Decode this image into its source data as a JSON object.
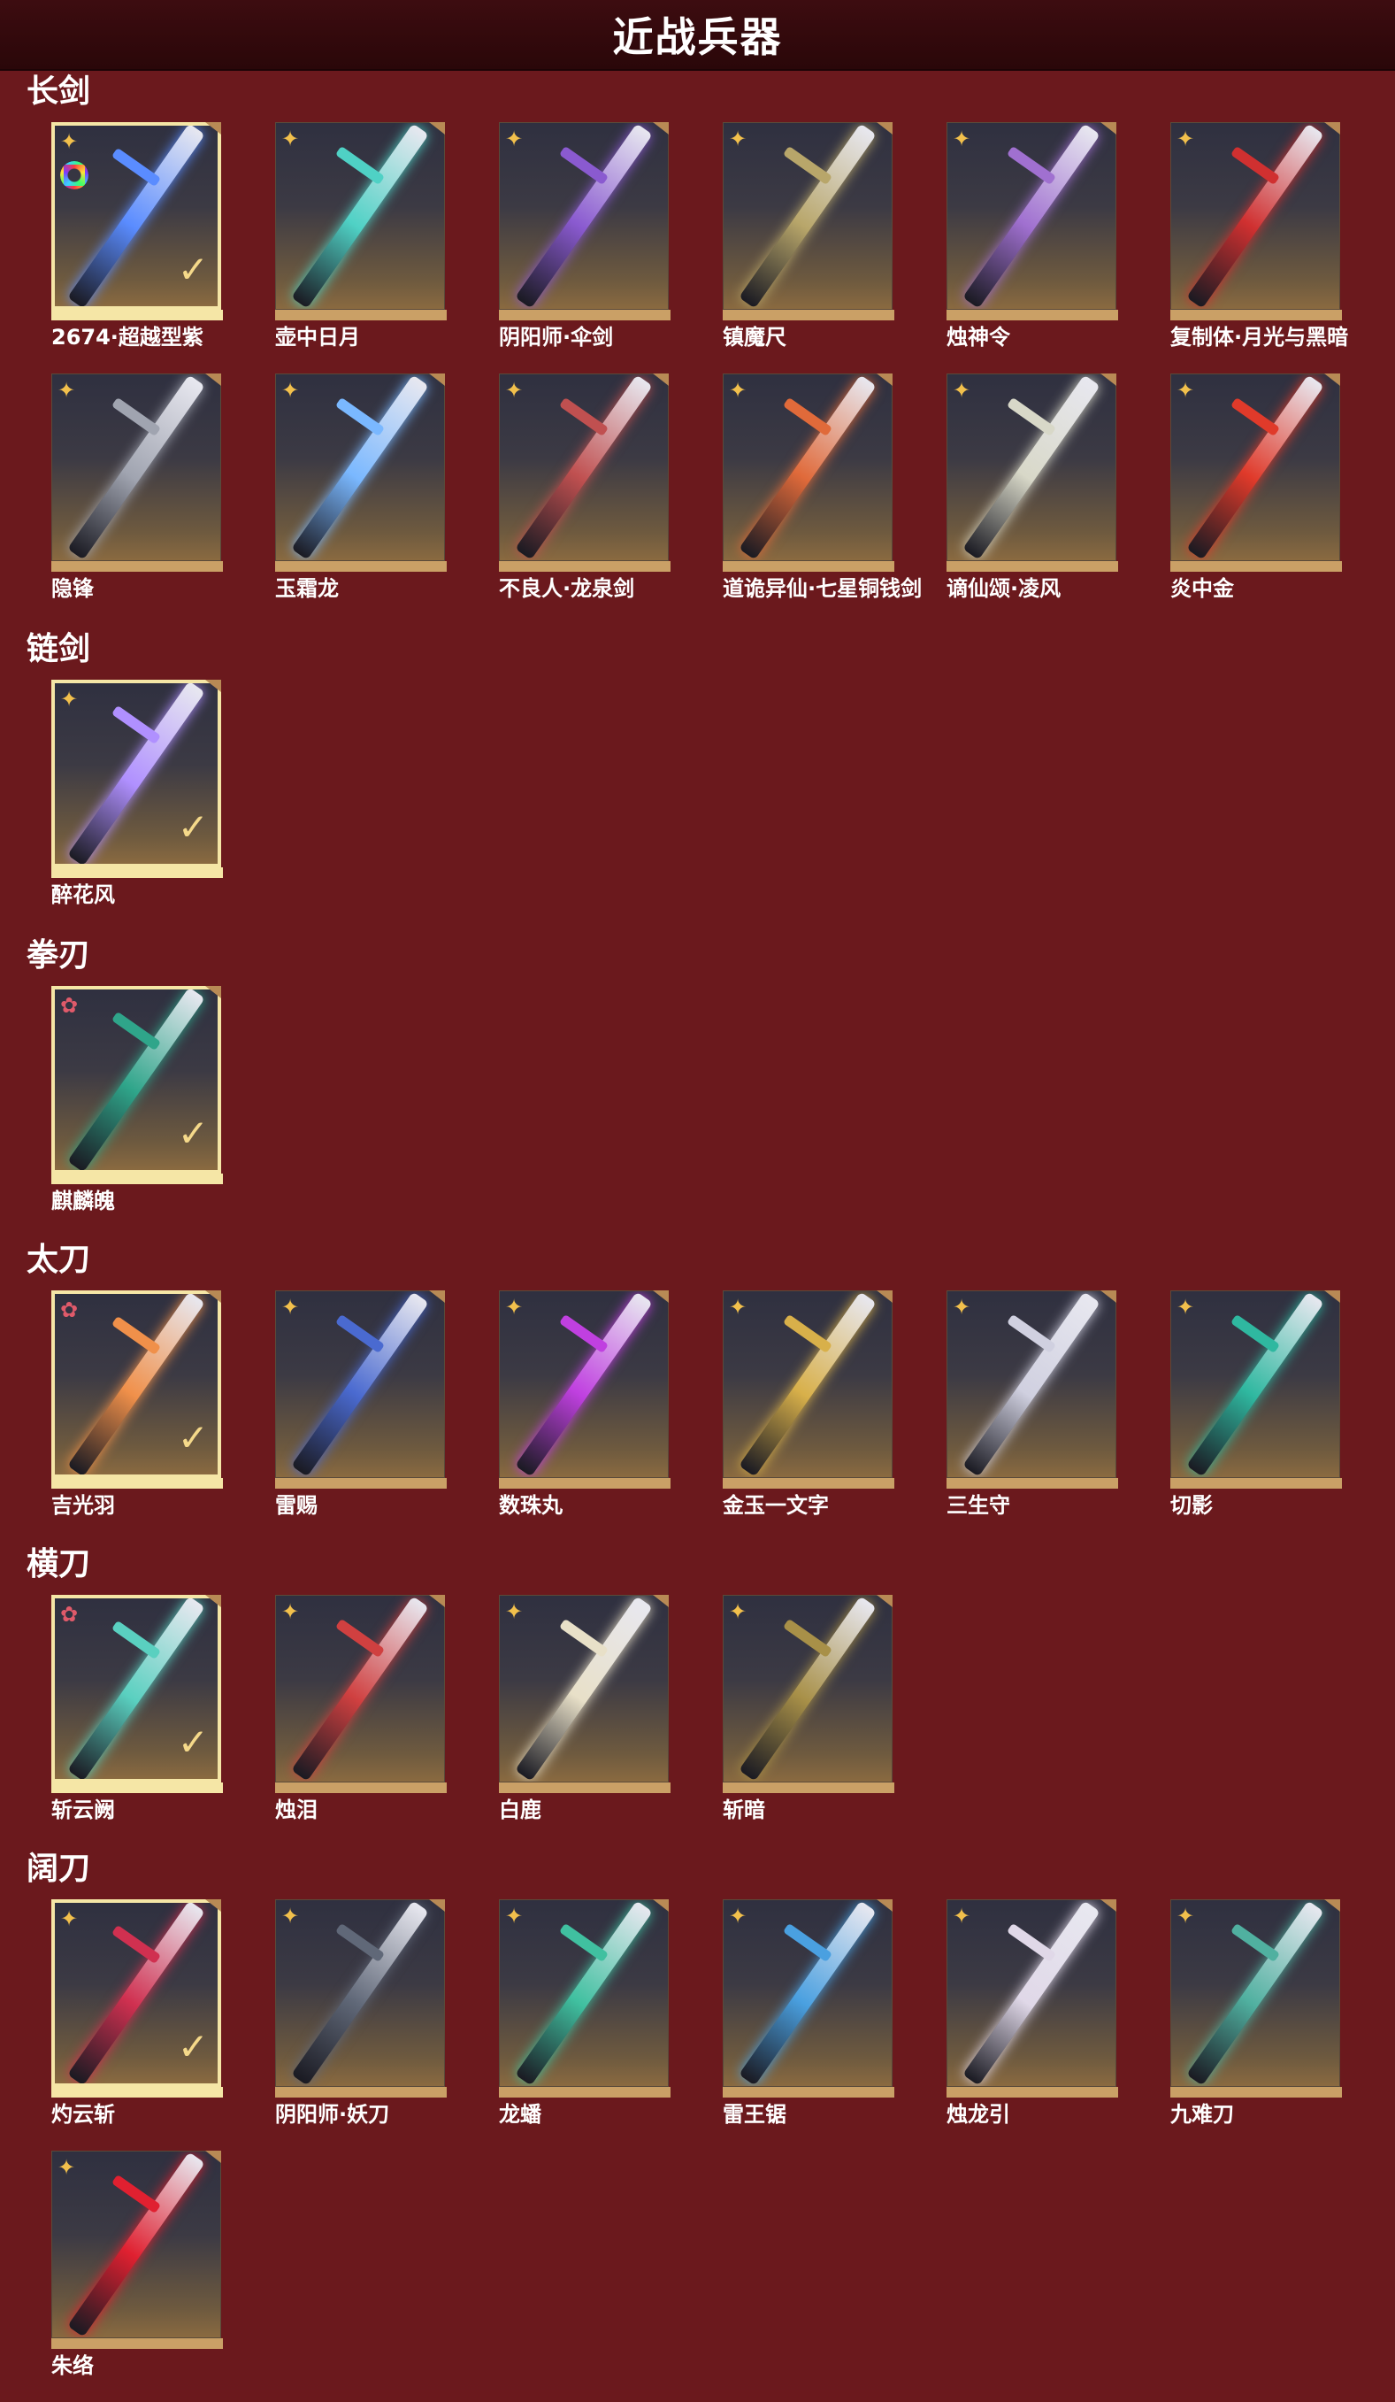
{
  "page_title": "近战兵器",
  "sections": [
    {
      "title": "长剑",
      "items": [
        {
          "name": "2674·超越型紫",
          "rarity": "gold",
          "selected": true,
          "has_color_ring": true,
          "color": "#5a8cff"
        },
        {
          "name": "壶中日月",
          "rarity": "gold",
          "selected": false,
          "color": "#4fd1c5"
        },
        {
          "name": "阴阳师·伞剑",
          "rarity": "gold",
          "selected": false,
          "color": "#8a5ad0"
        },
        {
          "name": "镇魔尺",
          "rarity": "gold",
          "selected": false,
          "color": "#b8a66a"
        },
        {
          "name": "烛神令",
          "rarity": "gold",
          "selected": false,
          "color": "#a070d0"
        },
        {
          "name": "复制体·月光与黑暗",
          "rarity": "gold",
          "selected": false,
          "color": "#d03030"
        },
        {
          "name": "隐锋",
          "rarity": "gold",
          "selected": false,
          "color": "#a0a4b0"
        },
        {
          "name": "玉霜龙",
          "rarity": "gold",
          "selected": false,
          "color": "#7ab8ff"
        },
        {
          "name": "不良人·龙泉剑",
          "rarity": "gold",
          "selected": false,
          "color": "#c05050"
        },
        {
          "name": "道诡异仙·七星铜钱剑",
          "rarity": "gold",
          "selected": false,
          "color": "#e06a3a"
        },
        {
          "name": "谪仙颂·凌风",
          "rarity": "gold",
          "selected": false,
          "color": "#d8d8c8"
        },
        {
          "name": "炎中金",
          "rarity": "gold",
          "selected": false,
          "color": "#e03a2a"
        }
      ]
    },
    {
      "title": "链剑",
      "items": [
        {
          "name": "醉花风",
          "rarity": "gold",
          "selected": true,
          "color": "#b090ff"
        }
      ]
    },
    {
      "title": "拳刃",
      "items": [
        {
          "name": "麒麟魄",
          "rarity": "red",
          "selected": true,
          "color": "#2fa58a"
        }
      ]
    },
    {
      "title": "太刀",
      "items": [
        {
          "name": "吉光羽",
          "rarity": "red",
          "selected": true,
          "color": "#f0904a"
        },
        {
          "name": "雷赐",
          "rarity": "gold",
          "selected": false,
          "color": "#4a6ad0"
        },
        {
          "name": "数珠丸",
          "rarity": "gold",
          "selected": false,
          "color": "#c040e0"
        },
        {
          "name": "金玉一文字",
          "rarity": "gold",
          "selected": false,
          "color": "#d8b04a"
        },
        {
          "name": "三生守",
          "rarity": "gold",
          "selected": false,
          "color": "#d0d0e0"
        },
        {
          "name": "切影",
          "rarity": "gold",
          "selected": false,
          "color": "#2fb8a0"
        }
      ]
    },
    {
      "title": "横刀",
      "items": [
        {
          "name": "斩云阙",
          "rarity": "red",
          "selected": true,
          "color": "#5ad0c0"
        },
        {
          "name": "烛泪",
          "rarity": "gold",
          "selected": false,
          "color": "#d04040"
        },
        {
          "name": "白鹿",
          "rarity": "gold",
          "selected": false,
          "color": "#e8e0c8"
        },
        {
          "name": "斩暗",
          "rarity": "gold",
          "selected": false,
          "color": "#a89048"
        }
      ]
    },
    {
      "title": "阔刀",
      "items": [
        {
          "name": "灼云斩",
          "rarity": "gold",
          "selected": true,
          "color": "#d03050"
        },
        {
          "name": "阴阳师·妖刀",
          "rarity": "gold",
          "selected": false,
          "color": "#606878"
        },
        {
          "name": "龙蟠",
          "rarity": "gold",
          "selected": false,
          "color": "#40c0a0"
        },
        {
          "name": "雷王锯",
          "rarity": "gold",
          "selected": false,
          "color": "#4aa0e0"
        },
        {
          "name": "烛龙引",
          "rarity": "gold",
          "selected": false,
          "color": "#e0d8e8"
        },
        {
          "name": "九难刀",
          "rarity": "gold",
          "selected": false,
          "color": "#50b0a0"
        },
        {
          "name": "朱络",
          "rarity": "gold",
          "selected": false,
          "color": "#e02030"
        }
      ]
    }
  ]
}
